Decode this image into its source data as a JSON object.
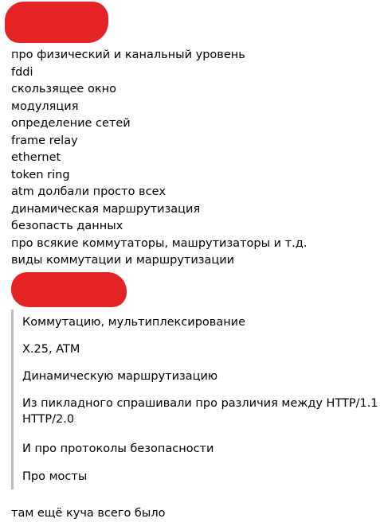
{
  "colors": {
    "redaction": "#e42424",
    "quote_bar": "#bcbcbc",
    "text": "#000000"
  },
  "list": {
    "items": [
      "про физический и канальный уровень",
      "fddi",
      "скользящее окно",
      "модуляция",
      "определение сетей",
      "frame relay",
      "ethernet",
      "token ring",
      "atm долбали просто всех",
      "динамическая маршрутизация",
      "безопасть данных",
      "про всякие коммутаторы, машрутизаторы и т.д.",
      "виды коммутации и маршрутизации"
    ]
  },
  "quote": {
    "lines": [
      "Коммутацию, мультиплексирование",
      "X.25, ATM",
      "Динамическую маршрутизацию",
      "Из пикладного спрашивали про различия между HTTP/1.1 и",
      "HTTP/2.0",
      "И про протоколы безопасности",
      "Про мосты"
    ]
  },
  "footer": {
    "text": "там ещё куча всего было"
  }
}
